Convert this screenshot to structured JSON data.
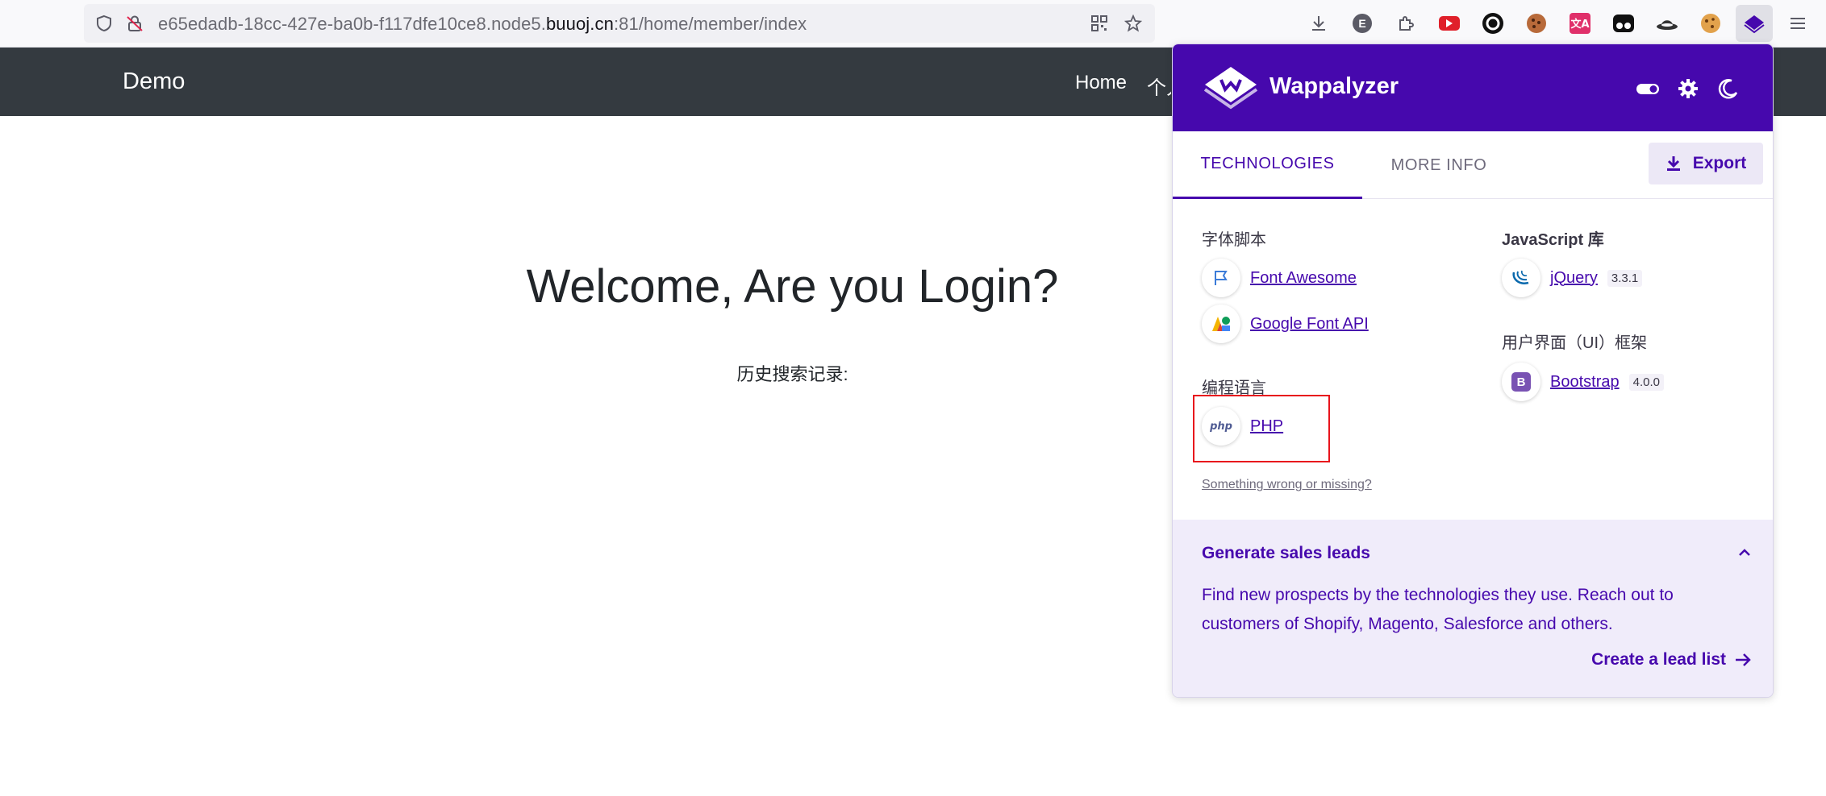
{
  "browser": {
    "url_prefix": "e65edadb-18cc-427e-ba0b-f117dfe10ce8.node5.",
    "url_host": "buuoj.cn",
    "url_suffix": ":81/home/member/index",
    "ext_e_label": "E",
    "ext_translate_label": "文A"
  },
  "page": {
    "brand": "Demo",
    "nav_home": "Home",
    "nav_personal": "个人",
    "welcome": "Welcome, Are you Login?",
    "history": "历史搜索记录:"
  },
  "wappalyzer": {
    "title": "Wappalyzer",
    "tabs": [
      "TECHNOLOGIES",
      "MORE INFO"
    ],
    "export_label": "Export",
    "categories": {
      "font_scripts": {
        "label": "字体脚本",
        "items": [
          {
            "name": "Font Awesome",
            "icon": "font-awesome-flag-icon"
          },
          {
            "name": "Google Font API",
            "icon": "google-fonts-icon"
          }
        ]
      },
      "programming_languages": {
        "label": "编程语言",
        "items": [
          {
            "name": "PHP",
            "icon": "php-icon",
            "icon_text": "php"
          }
        ]
      },
      "js_libraries": {
        "label": "JavaScript 库",
        "items": [
          {
            "name": "jQuery",
            "version": "3.3.1",
            "icon": "jquery-icon"
          }
        ]
      },
      "ui_frameworks": {
        "label": "用户界面（UI）框架",
        "items": [
          {
            "name": "Bootstrap",
            "version": "4.0.0",
            "icon": "bootstrap-icon",
            "icon_text": "B"
          }
        ]
      }
    },
    "something_wrong": "Something wrong or missing?",
    "leads": {
      "title": "Generate sales leads",
      "text": "Find new prospects by the technologies they use. Reach out to customers of Shopify, Magento, Salesforce and others.",
      "link": "Create a lead list"
    }
  },
  "colors": {
    "wappalyzer_purple": "#4608ad",
    "navbar": "#343a40",
    "highlight": "#e8141c"
  }
}
